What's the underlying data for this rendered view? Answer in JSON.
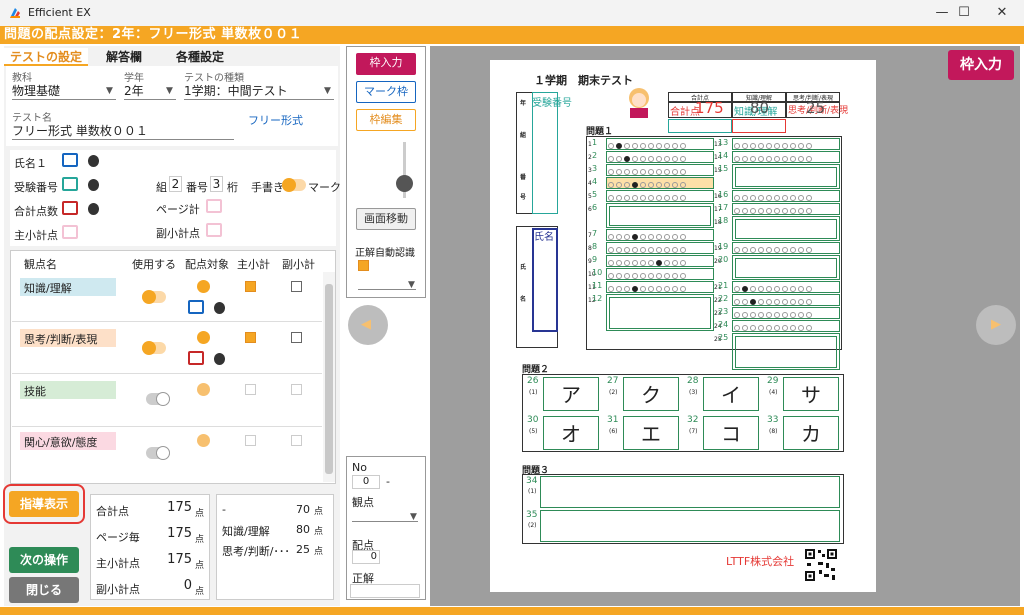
{
  "window": {
    "title": "Efficient EX",
    "minimize": "—",
    "maximize": "☐",
    "close": "✕"
  },
  "heading": "問題の配点設定：2年：フリー形式 単数枚００１",
  "tabs": [
    {
      "label": "テストの設定"
    },
    {
      "label": "解答欄"
    },
    {
      "label": "各種設定"
    }
  ],
  "fields": {
    "subject": {
      "label": "教科",
      "value": "物理基礎"
    },
    "grade": {
      "label": "学年",
      "value": "2年"
    },
    "test_type": {
      "label": "テストの種類",
      "value": "1学期：中間テスト"
    },
    "test_name": {
      "label": "テスト名",
      "value": "フリー形式 単数枚００１"
    },
    "format_link": "フリー形式"
  },
  "settings": {
    "name1": "氏名１",
    "exam_no": "受験番号",
    "total_count": "合計点数",
    "subtotal": "主小計点",
    "class_label": "組",
    "class_val": "2",
    "number_label": "番号",
    "number_val": "3",
    "digits_label": "桁",
    "handwrite": "手書き",
    "mark": "マーク",
    "page_total": "ページ計",
    "sub_subtotal": "副小計点"
  },
  "viewpoint_table": {
    "headers": [
      "観点名",
      "使用する",
      "配点対象",
      "主小計",
      "副小計"
    ],
    "rows": [
      {
        "name": "知識/理解",
        "color": "#cfe9f0"
      },
      {
        "name": "思考/判断/表現",
        "color": "#fde0c8"
      },
      {
        "name": "技能",
        "color": "#d6ecd6"
      },
      {
        "name": "関心/意欲/態度",
        "color": "#fbd9e2"
      }
    ]
  },
  "guide_button": "指導表示",
  "next_button": "次の操作",
  "close_button": "閉じる",
  "stats": [
    {
      "label": "合計点",
      "value": "175",
      "unit": "点"
    },
    {
      "label": "ページ毎",
      "value": "175",
      "unit": "点"
    },
    {
      "label": "主小計点",
      "value": "175",
      "unit": "点"
    },
    {
      "label": "副小計点",
      "value": "0",
      "unit": "点"
    }
  ],
  "breakdown": [
    {
      "label": "-",
      "value": "70",
      "unit": "点"
    },
    {
      "label": "知識/理解",
      "value": "80",
      "unit": "点"
    },
    {
      "label": "思考/判断/･･･",
      "value": "25",
      "unit": "点"
    }
  ],
  "center": {
    "frame_input": "枠入力",
    "mark_frame": "マーク枠",
    "frame_edit": "枠編集",
    "screen_move": "画面移動",
    "auto_recognize": "正解自動認識"
  },
  "bottom_panel": {
    "no_label": "No",
    "no_value": "0",
    "no_dash": "-",
    "viewpoint_label": "観点",
    "score_label": "配点",
    "score_value": "0",
    "answer_label": "正解"
  },
  "frame_input_top": "枠入力",
  "paper": {
    "title": "１学期　期末テスト",
    "col_total": "合計点",
    "col_knowledge": "知識/理解",
    "col_thinking": "思考/判断/表現",
    "overlay_total": "合計点",
    "overlay_total_val": "175",
    "overlay_knowledge": "知識/理解",
    "overlay_knowledge_val": "80",
    "overlay_thinking": "思考/判断/表現",
    "overlay_thinking_val": "25",
    "exam_no_label": "受験番号",
    "name_label": "氏名",
    "side_labels": [
      "年",
      "組",
      "番",
      "号",
      "氏",
      "名"
    ],
    "q1": "問題１",
    "q2": "問題２",
    "q3": "問題３",
    "q1_left_nums": [
      "1",
      "2",
      "3",
      "4",
      "5",
      "6",
      "7",
      "8",
      "9",
      "10",
      "11",
      "12"
    ],
    "q1_right_nums": [
      "13",
      "14",
      "15",
      "16",
      "17",
      "18",
      "19",
      "20",
      "21",
      "22",
      "23",
      "24",
      "25"
    ],
    "q1_left_row_labels": [
      "1",
      "2",
      "3",
      "4",
      "5",
      "6",
      "7",
      "8",
      "9",
      "10",
      "11",
      "12"
    ],
    "q1_right_row_labels": [
      "13",
      "14",
      "15",
      "16",
      "17",
      "18",
      "19",
      "20",
      "21",
      "22",
      "23",
      "24",
      "25"
    ],
    "q2_cells": [
      {
        "n": "26",
        "sub": "(1)",
        "kana": "ア"
      },
      {
        "n": "27",
        "sub": "(2)",
        "kana": "ク"
      },
      {
        "n": "28",
        "sub": "(3)",
        "kana": "イ"
      },
      {
        "n": "29",
        "sub": "(4)",
        "kana": "サ"
      },
      {
        "n": "30",
        "sub": "(5)",
        "kana": "オ"
      },
      {
        "n": "31",
        "sub": "(6)",
        "kana": "エ"
      },
      {
        "n": "32",
        "sub": "(7)",
        "kana": "コ"
      },
      {
        "n": "33",
        "sub": "(8)",
        "kana": "カ"
      }
    ],
    "q3_cells": [
      {
        "n": "34",
        "sub": "(1)"
      },
      {
        "n": "35",
        "sub": "(2)"
      }
    ],
    "company": "LTTF株式会社"
  },
  "nav": {
    "prev": "◀",
    "next": "▶"
  },
  "colors": {
    "accent": "#f5a623",
    "green": "#2e8b57",
    "pink": "#c2185b",
    "blue": "#1565c0"
  }
}
